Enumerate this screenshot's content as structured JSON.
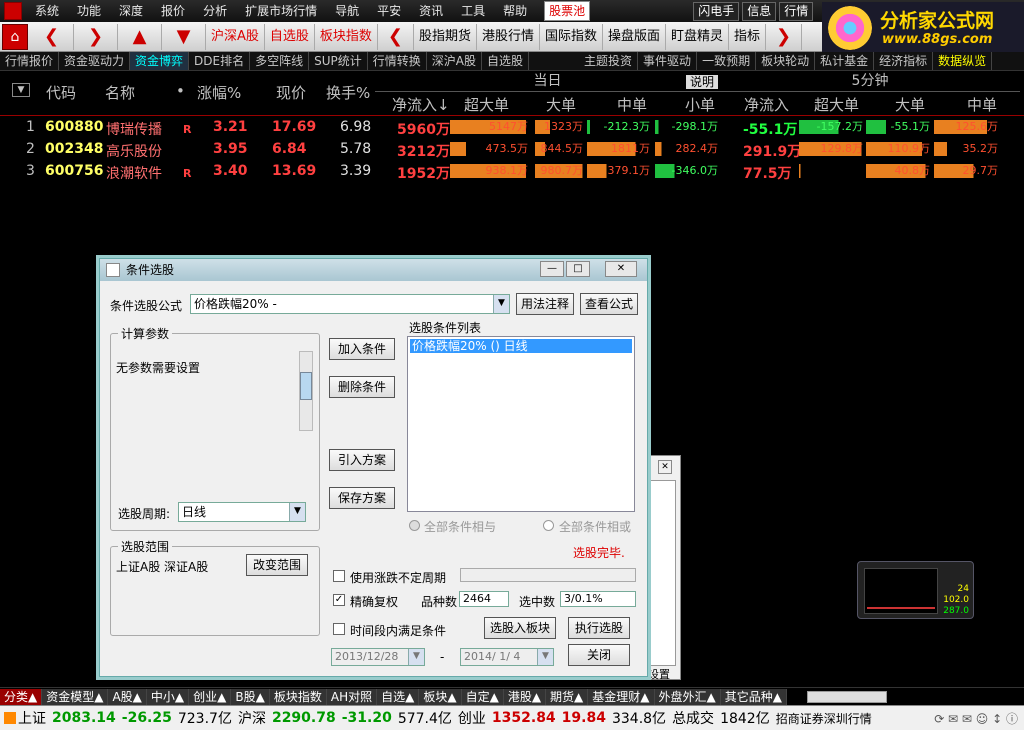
{
  "menu": [
    "系统",
    "功能",
    "深度",
    "报价",
    "分析",
    "扩展市场行情",
    "导航",
    "平安",
    "资讯",
    "工具",
    "帮助"
  ],
  "menu_pool": "股票池",
  "menu_right": [
    "闪电手",
    "信息",
    "行情"
  ],
  "brand": {
    "title": "分析家公式网",
    "url": "www.88gs.com"
  },
  "toolbar": [
    "沪深A股",
    "自选股",
    "板块指数",
    "股指期货",
    "港股行情",
    "国际指数",
    "操盘版面",
    "盯盘精灵",
    "指标"
  ],
  "tabs": [
    "行情报价",
    "资金驱动力",
    "资金博弈",
    "DDE排名",
    "多空阵线",
    "SUP统计",
    "行情转换",
    "深沪A股",
    "自选股",
    "主题投资",
    "事件驱动",
    "一致预期",
    "板块轮动",
    "私计基金",
    "经济指标",
    "数据纵览"
  ],
  "header": {
    "code": "代码",
    "name": "名称",
    "dot": "•",
    "change": "涨幅%",
    "price": "现价",
    "turnover": "换手%",
    "group1": "当日",
    "group2": "5分钟",
    "explain": "说明",
    "cols": [
      "净流入↓",
      "超大单",
      "大单",
      "中单",
      "小单",
      "净流入",
      "超大单",
      "大单",
      "中单"
    ]
  },
  "rows": [
    {
      "idx": "1",
      "code": "600880",
      "name": "博瑞传播",
      "flag": "R",
      "change": "3.21",
      "price": "17.69",
      "turnover": "6.98",
      "net": "5960万",
      "b": [
        {
          "v": "5147万",
          "c": "#e88020",
          "w": 0.95
        },
        {
          "v": "1323万",
          "c": "#e88020",
          "w": 0.3
        },
        {
          "v": "-212.3万",
          "c": "#20c040",
          "w": 0.05
        },
        {
          "v": "-298.1万",
          "c": "#20c040",
          "w": 0.05
        }
      ],
      "net5": "-55.1万",
      "net5c": "#20ff40",
      "b5": [
        {
          "v": "-157.2万",
          "c": "#20c040",
          "w": 0.6
        },
        {
          "v": "-55.1万",
          "c": "#20c040",
          "w": 0.3
        },
        {
          "v": "125.6万",
          "c": "#e88020",
          "w": 0.8
        }
      ]
    },
    {
      "idx": "2",
      "code": "002348",
      "name": "高乐股份",
      "flag": "",
      "change": "3.95",
      "price": "6.84",
      "turnover": "5.78",
      "net": "3212万",
      "b": [
        {
          "v": "473.5万",
          "c": "#e88020",
          "w": 0.2
        },
        {
          "v": "844.5万",
          "c": "#e88020",
          "w": 0.2
        },
        {
          "v": "1811万",
          "c": "#e88020",
          "w": 0.75
        },
        {
          "v": "282.4万",
          "c": "#e88020",
          "w": 0.1
        }
      ],
      "net5": "291.9万",
      "net5c": "#ff4040",
      "b5": [
        {
          "v": "129.8万",
          "c": "#e88020",
          "w": 0.95
        },
        {
          "v": "110.9万",
          "c": "#e88020",
          "w": 0.85
        },
        {
          "v": "35.2万",
          "c": "#e88020",
          "w": 0.2
        }
      ]
    },
    {
      "idx": "3",
      "code": "600756",
      "name": "浪潮软件",
      "flag": "R",
      "change": "3.40",
      "price": "13.69",
      "turnover": "3.39",
      "net": "1952万",
      "b": [
        {
          "v": "938.1万",
          "c": "#e88020",
          "w": 0.95
        },
        {
          "v": "980.7万",
          "c": "#e88020",
          "w": 0.95
        },
        {
          "v": "379.1万",
          "c": "#e88020",
          "w": 0.3
        },
        {
          "v": "-346.0万",
          "c": "#20c040",
          "w": 0.3
        }
      ],
      "net5": "77.5万",
      "net5c": "#ff4040",
      "b5": [
        {
          "v": "",
          "c": "#e88020",
          "w": 0.02
        },
        {
          "v": "40.8万",
          "c": "#e88020",
          "w": 0.9
        },
        {
          "v": "29.7万",
          "c": "#e88020",
          "w": 0.6
        }
      ]
    }
  ],
  "dialog": {
    "title": "条件选股",
    "formula_label": "条件选股公式",
    "formula_value": "价格跌幅20% -",
    "usage_btn": "用法注释",
    "view_btn": "查看公式",
    "params_label": "计算参数",
    "params_text": "无参数需要设置",
    "period_label": "选股周期:",
    "period_value": "日线",
    "add_btn": "加入条件",
    "del_btn": "删除条件",
    "import_btn": "引入方案",
    "save_btn": "保存方案",
    "list_label": "选股条件列表",
    "list_item": "价格跌幅20% () 日线",
    "radio_and": "全部条件相与",
    "radio_or": "全部条件相或",
    "done": "选股完毕.",
    "range_label": "选股范围",
    "range_value": "上证A股 深证A股",
    "range_btn": "改变范围",
    "chk_unfixed": "使用涨跌不定周期",
    "chk_exact": "精确复权",
    "count_label": "品种数",
    "count_value": "2464",
    "selected_label": "选中数",
    "selected_value": "3/0.1%",
    "chk_period": "时间段内满足条件",
    "to_block_btn": "选股入板块",
    "exec_btn": "执行选股",
    "close_btn": "关闭",
    "date_from": "2013/12/28",
    "date_to": "2014/ 1/ 4",
    "dash": "-"
  },
  "bottom_tabs": [
    "分类▲",
    "资金模型▲",
    "A股▲",
    "中小▲",
    "创业▲",
    "B股▲",
    "板块指数",
    "AH对照",
    "自选▲",
    "板块▲",
    "自定▲",
    "港股▲",
    "期货▲",
    "基金理财▲",
    "外盘外汇▲",
    "其它品种▲"
  ],
  "status": {
    "sh_label": "上证",
    "sh_val": "2083.14",
    "sh_chg": "-26.25",
    "sh_amt": "723.7亿",
    "hs_label": "沪深",
    "hs_val": "2290.78",
    "hs_chg": "-31.20",
    "hs_amt": "577.4亿",
    "cy_label": "创业",
    "cy_val": "1352.84",
    "cy_chg": "19.84",
    "cy_amt": "334.8亿",
    "total_label": "总成交",
    "total_val": "1842亿",
    "broker": "招商证券深圳行情"
  },
  "mini": {
    "v1": "24",
    "v2": "102.0",
    "v3": "287.0"
  },
  "setting_label": "设置"
}
